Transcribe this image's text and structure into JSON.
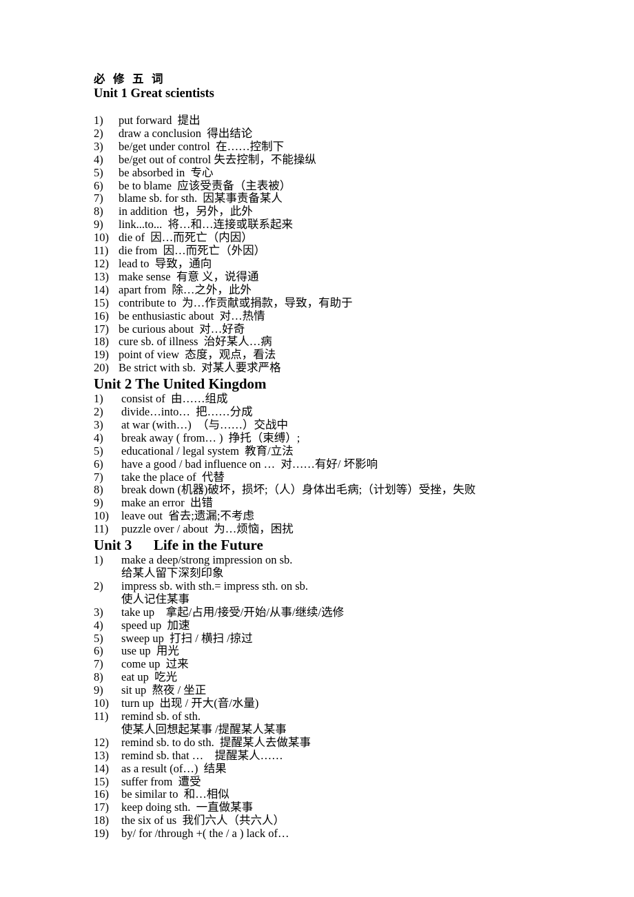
{
  "document": {
    "title": "必  修  五  词"
  },
  "units": [
    {
      "heading": "Unit 1 Great scientists",
      "items": [
        {
          "num": "1)",
          "text": "put forward  提出"
        },
        {
          "num": "2)",
          "text": "draw a conclusion  得出结论"
        },
        {
          "num": "3)",
          "text": "be/get under control  在……控制下"
        },
        {
          "num": "4)",
          "text": "be/get out of control 失去控制，不能操纵"
        },
        {
          "num": "5)",
          "text": "be absorbed in  专心"
        },
        {
          "num": "6)",
          "text": "be to blame  应该受责备（主表被）"
        },
        {
          "num": "7)",
          "text": "blame sb. for sth.  因某事责备某人"
        },
        {
          "num": "8)",
          "text": "in addition  也，另外，此外"
        },
        {
          "num": "9)",
          "text": "link...to...  将…和…连接或联系起来"
        },
        {
          "num": "10)",
          "text": "die of  因…而死亡（内因）"
        },
        {
          "num": "11)",
          "text": "die from  因…而死亡（外因）"
        },
        {
          "num": "12)",
          "text": "lead to  导致，通向"
        },
        {
          "num": "13)",
          "text": "make sense  有意 义，说得通"
        },
        {
          "num": "14)",
          "text": "apart from  除…之外，此外"
        },
        {
          "num": "15)",
          "text": "contribute to  为…作贡献或捐款，导致，有助于"
        },
        {
          "num": "16)",
          "text": "be enthusiastic about  对…热情"
        },
        {
          "num": "17)",
          "text": "be curious about  对…好奇"
        },
        {
          "num": "18)",
          "text": "cure sb. of illness  治好某人…病"
        },
        {
          "num": "19)",
          "text": "point of view  态度，观点，看法"
        },
        {
          "num": "20)",
          "text": "Be strict with sb.  对某人要求严格"
        }
      ]
    },
    {
      "heading": "Unit 2 The United Kingdom",
      "items": [
        {
          "num": "1)",
          "text": "consist of  由……组成"
        },
        {
          "num": "2)",
          "text": "divide…into…  把……分成"
        },
        {
          "num": "3)",
          "text": "at war (with…)  （与……）交战中"
        },
        {
          "num": "4)",
          "text": "break away ( from… )  挣托（束缚）;"
        },
        {
          "num": "5)",
          "text": "educational / legal system  教育/立法"
        },
        {
          "num": "6)",
          "text": "have a good / bad influence on …  对……有好/ 坏影响"
        },
        {
          "num": "7)",
          "text": "take the place of  代替"
        },
        {
          "num": "8)",
          "text": "break down (机器)破坏，损坏;（人）身体出毛病;（计划等）受挫，失败"
        },
        {
          "num": "9)",
          "text": "make an error  出错"
        },
        {
          "num": "10)",
          "text": "leave out  省去;遗漏;不考虑"
        },
        {
          "num": "11)",
          "text": "puzzle over / about  为…烦恼，困扰"
        }
      ]
    },
    {
      "heading": "Unit 3      Life in the Future",
      "items": [
        {
          "num": "1)",
          "text": "make a deep/strong impression on sb.",
          "sub": "给某人留下深刻印象"
        },
        {
          "num": "2)",
          "text": "impress sb. with sth.= impress sth. on sb.",
          "sub": "使人记住某事"
        },
        {
          "num": "3)",
          "text": "take up    拿起/占用/接受/开始/从事/继续/选修"
        },
        {
          "num": "4)",
          "text": "speed up  加速"
        },
        {
          "num": "5)",
          "text": "sweep up  打扫 / 横扫 /掠过"
        },
        {
          "num": "6)",
          "text": "use up  用光"
        },
        {
          "num": "7)",
          "text": "come up  过来"
        },
        {
          "num": "8)",
          "text": "eat up  吃光"
        },
        {
          "num": "9)",
          "text": "sit up  熬夜 / 坐正"
        },
        {
          "num": "10)",
          "text": "turn up  出现 / 开大(音/水量)"
        },
        {
          "num": "11)",
          "text": "remind sb. of sth.",
          "sub": "使某人回想起某事 /提醒某人某事"
        },
        {
          "num": "12)",
          "text": "remind sb. to do sth.  提醒某人去做某事"
        },
        {
          "num": "13)",
          "text": "remind sb. that …    提醒某人……"
        },
        {
          "num": "14)",
          "text": "as a result (of…)  结果"
        },
        {
          "num": "15)",
          "text": "suffer from  遭受"
        },
        {
          "num": "16)",
          "text": "be similar to  和…相似"
        },
        {
          "num": "17)",
          "text": "keep doing sth.  一直做某事"
        },
        {
          "num": "18)",
          "text": "the six of us  我们六人（共六人）"
        },
        {
          "num": "19)",
          "text": "by/ for /through +( the / a ) lack of…"
        }
      ]
    }
  ]
}
